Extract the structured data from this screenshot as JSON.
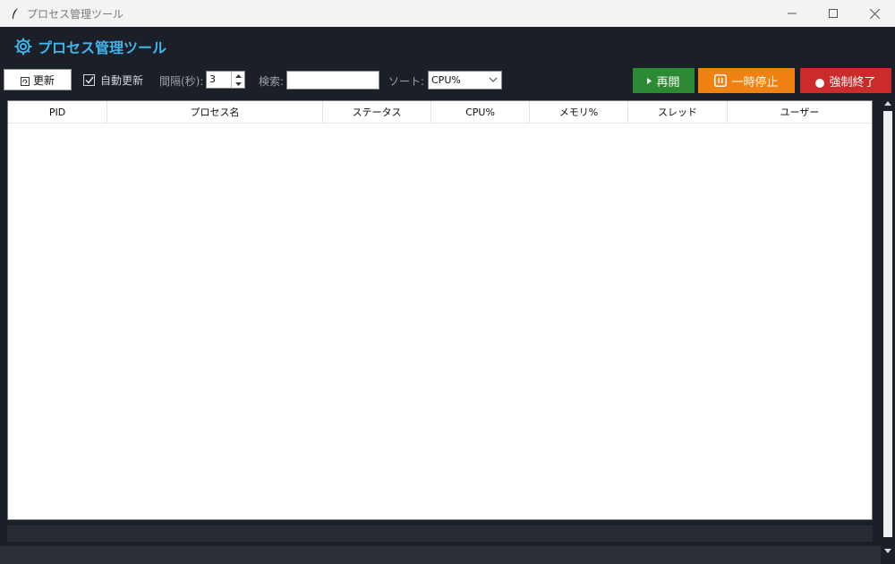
{
  "window": {
    "title": "プロセス管理ツール",
    "icon": "feather-icon",
    "controls": [
      "minimize-icon",
      "maximize-icon",
      "close-icon"
    ]
  },
  "header": {
    "icon": "gear-icon",
    "title": "プロセス管理ツール"
  },
  "toolbar": {
    "refresh_label": "更新",
    "auto_refresh_label": "自動更新",
    "auto_refresh_checked": true,
    "interval_label": "間隔(秒):",
    "interval_value": "3",
    "search_label": "検索:",
    "search_value": "",
    "sort_label": "ソート:",
    "sort_value": "CPU%"
  },
  "actions": {
    "resume_label": "再開",
    "pause_label": "一時停止",
    "kill_label": "強制終了"
  },
  "colors": {
    "accent": "#3fb6ec",
    "resume": "#2d8a34",
    "pause": "#f08113",
    "kill": "#cc2b2b",
    "background": "#1b1f27"
  },
  "table": {
    "columns": [
      "PID",
      "プロセス名",
      "ステータス",
      "CPU%",
      "メモリ%",
      "スレッド",
      "ユーザー"
    ],
    "rows": []
  }
}
